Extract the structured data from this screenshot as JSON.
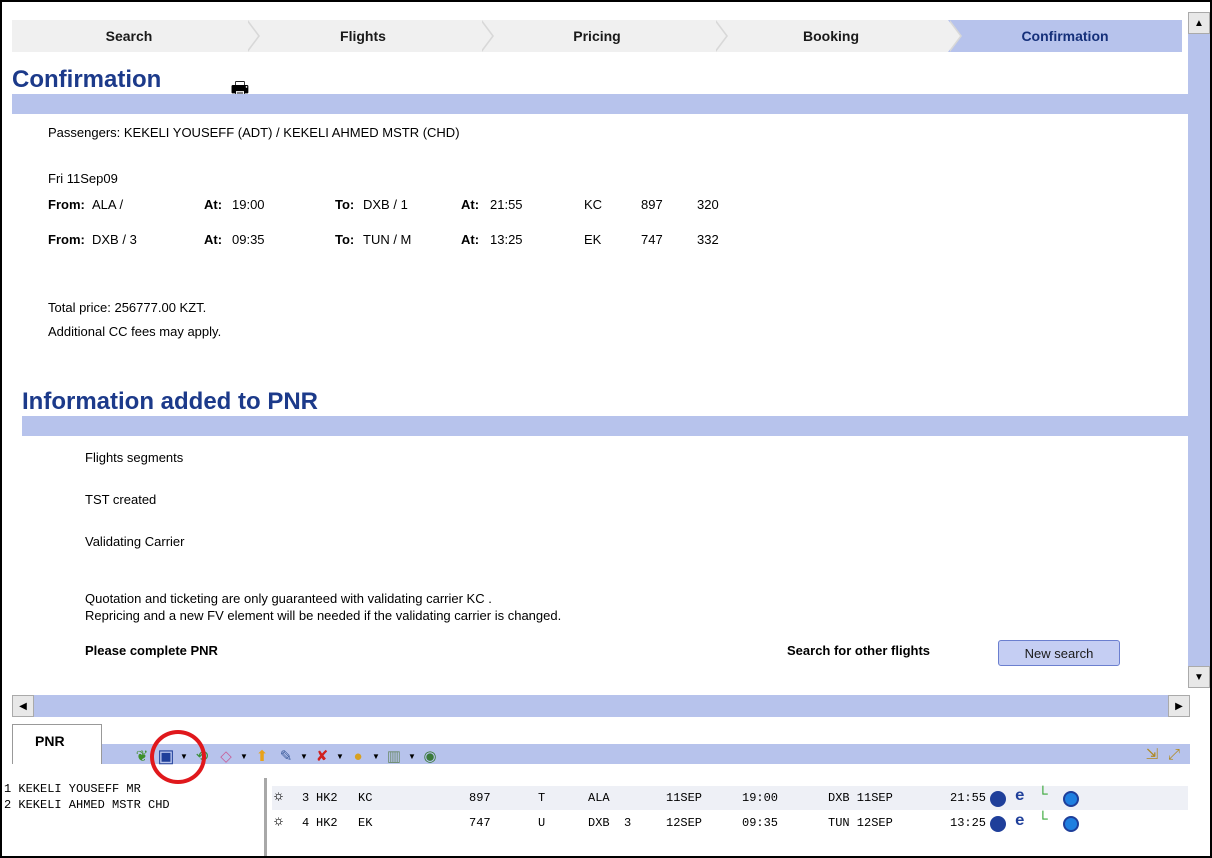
{
  "wizard_steps": [
    "Search",
    "Flights",
    "Pricing",
    "Booking",
    "Confirmation"
  ],
  "confirmation": {
    "title": "Confirmation",
    "passengers": "Passengers: KEKELI YOUSEFF (ADT) / KEKELI AHMED MSTR (CHD)",
    "date": "Fri 11Sep09",
    "segments": [
      {
        "from_label": "From:",
        "from": "ALA /",
        "at_label": "At:",
        "dep": "19:00",
        "to_label": "To:",
        "to": "DXB / 1",
        "at2_label": "At:",
        "arr": "21:55",
        "airline": "KC",
        "flight": "897",
        "equipment": "320"
      },
      {
        "from_label": "From:",
        "from": "DXB / 3",
        "at_label": "At:",
        "dep": "09:35",
        "to_label": "To:",
        "to": "TUN / M",
        "at2_label": "At:",
        "arr": "13:25",
        "airline": "EK",
        "flight": "747",
        "equipment": "332"
      }
    ],
    "total_price": "Total price: 256777.00 KZT.",
    "cc_fees": "Additional CC fees may apply."
  },
  "pnr_info": {
    "title": "Information added to PNR",
    "items": [
      "Flights segments",
      "TST created",
      "Validating Carrier"
    ],
    "note_line1": "Quotation and ticketing are only guaranteed with validating carrier KC .",
    "note_line2": "Repricing and a new FV element will be needed if the validating carrier is changed.",
    "complete_label": "Please complete PNR",
    "search_other_label": "Search for other flights",
    "new_search_button": "New search"
  },
  "pnr_panel": {
    "tab_label": "PNR",
    "passengers": [
      "1 KEKELI YOUSEFF MR",
      "2 KEKELI AHMED MSTR CHD"
    ],
    "segments": [
      {
        "num": "3",
        "status": "HK2",
        "airline": "KC",
        "flight": "897",
        "class": "T",
        "from": "ALA",
        "terminal": "",
        "date": "11SEP",
        "dep": "19:00",
        "to_date": "DXB 11SEP",
        "arr": "21:55"
      },
      {
        "num": "4",
        "status": "HK2",
        "airline": "EK",
        "flight": "747",
        "class": "U",
        "from": "DXB",
        "terminal": "3",
        "date": "12SEP",
        "dep": "09:35",
        "to_date": "TUN 12SEP",
        "arr": "13:25"
      }
    ],
    "toolbar_icons": [
      "green-leaf-icon",
      "save-icon",
      "refresh-doc-icon",
      "eraser-icon",
      "up-arrow-icon",
      "edit-icon",
      "delete-icon",
      "coin-icon",
      "chart-icon",
      "view-icon"
    ]
  },
  "colors": {
    "accent_band": "#b7c3ec",
    "heading": "#1c3a8a",
    "highlight_circle": "#e0181c"
  }
}
